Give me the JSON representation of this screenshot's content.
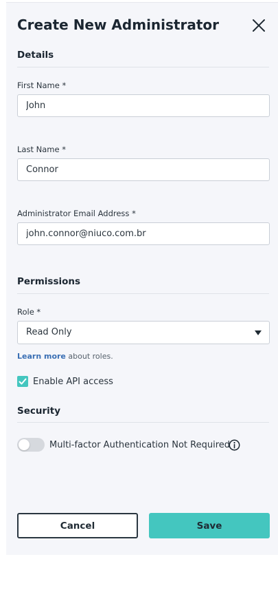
{
  "dialog": {
    "title": "Create New Administrator"
  },
  "details": {
    "heading": "Details",
    "first_name": {
      "label": "First Name *",
      "value": "John"
    },
    "last_name": {
      "label": "Last Name *",
      "value": "Connor"
    },
    "email": {
      "label": "Administrator Email Address *",
      "value": "john.connor@niuco.com.br"
    }
  },
  "permissions": {
    "heading": "Permissions",
    "role": {
      "label": "Role *",
      "selected": "Read Only"
    },
    "learn_more_link": "Learn more",
    "learn_more_suffix": "about roles.",
    "api_access": {
      "label": "Enable API access",
      "checked": true
    }
  },
  "security": {
    "heading": "Security",
    "mfa": {
      "label": "Multi-factor Authentication Not Required",
      "enabled": false
    }
  },
  "actions": {
    "cancel_label": "Cancel",
    "save_label": "Save"
  },
  "colors": {
    "accent": "#44c6bf",
    "link": "#3a6fb4",
    "panel_bg": "#f5f6fa"
  },
  "icons": {
    "close": "close-icon",
    "caret": "caret-down-icon",
    "check": "checkmark-icon",
    "info": "info-icon"
  }
}
